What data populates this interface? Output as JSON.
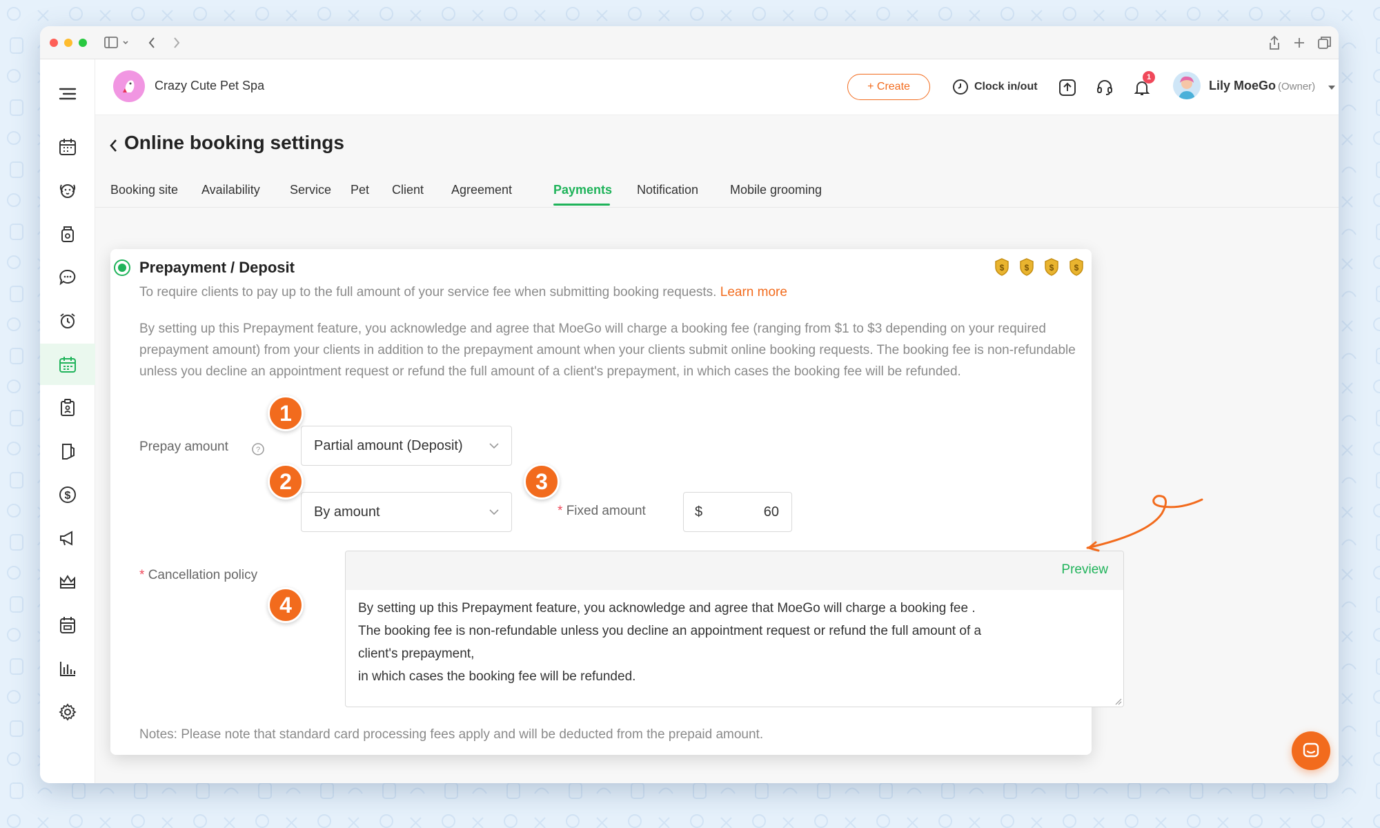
{
  "header": {
    "business_name": "Crazy Cute Pet Spa",
    "create_label": "+ Create",
    "clock_label": "Clock in/out",
    "notification_count": "1",
    "user_name": "Lily MoeGo",
    "user_role": "(Owner)"
  },
  "page": {
    "title": "Online booking settings"
  },
  "tabs": [
    {
      "label": "Booking site"
    },
    {
      "label": "Availability"
    },
    {
      "label": "Service"
    },
    {
      "label": "Pet"
    },
    {
      "label": "Client"
    },
    {
      "label": "Agreement"
    },
    {
      "label": "Payments"
    },
    {
      "label": "Notification"
    },
    {
      "label": "Mobile grooming"
    }
  ],
  "active_tab": "Payments",
  "prepayment": {
    "title": "Prepayment / Deposit",
    "description": "To require clients to pay up to the full amount of your service fee when submitting booking requests.",
    "learn_more": "Learn more",
    "disclaimer": "By setting up this Prepayment feature, you acknowledge and agree that MoeGo will charge a booking fee (ranging from $1 to $3 depending on your required prepayment amount) from your clients in addition to the prepayment amount when your clients submit online booking requests. The booking fee is non-refundable unless you decline an appointment request or refund the full amount of a client's prepayment, in which cases the booking fee will be refunded.",
    "prepay_label": "Prepay amount",
    "prepay_value": "Partial amount (Deposit)",
    "by_value": "By amount",
    "fixed_label": "Fixed amount",
    "currency": "$",
    "amount": "60",
    "cancellation_label": "Cancellation policy",
    "preview_label": "Preview",
    "policy_lines": [
      "By setting up this Prepayment feature, you acknowledge and agree that MoeGo will charge a booking fee .",
      "The booking fee is non-refundable unless you decline an appointment request or refund the full amount of a",
      "client's prepayment,",
      "in which cases the booking fee will be refunded."
    ],
    "notes": "Notes: Please note that standard card processing fees apply and will be deducted from the prepaid amount."
  },
  "steps": [
    "1",
    "2",
    "3",
    "4"
  ],
  "colors": {
    "accent_green": "#1fb35a",
    "accent_orange": "#f26b1d",
    "required_red": "#f0485a"
  },
  "sidebar_icons": [
    "menu-icon",
    "calendar-icon",
    "pet-icon",
    "grooming-icon",
    "chat-icon",
    "alarm-icon",
    "online-booking-icon",
    "clipboard-icon",
    "retail-icon",
    "payment-icon",
    "marketing-icon",
    "membership-icon",
    "reports-calendar-icon",
    "reports-chart-icon",
    "settings-icon"
  ]
}
